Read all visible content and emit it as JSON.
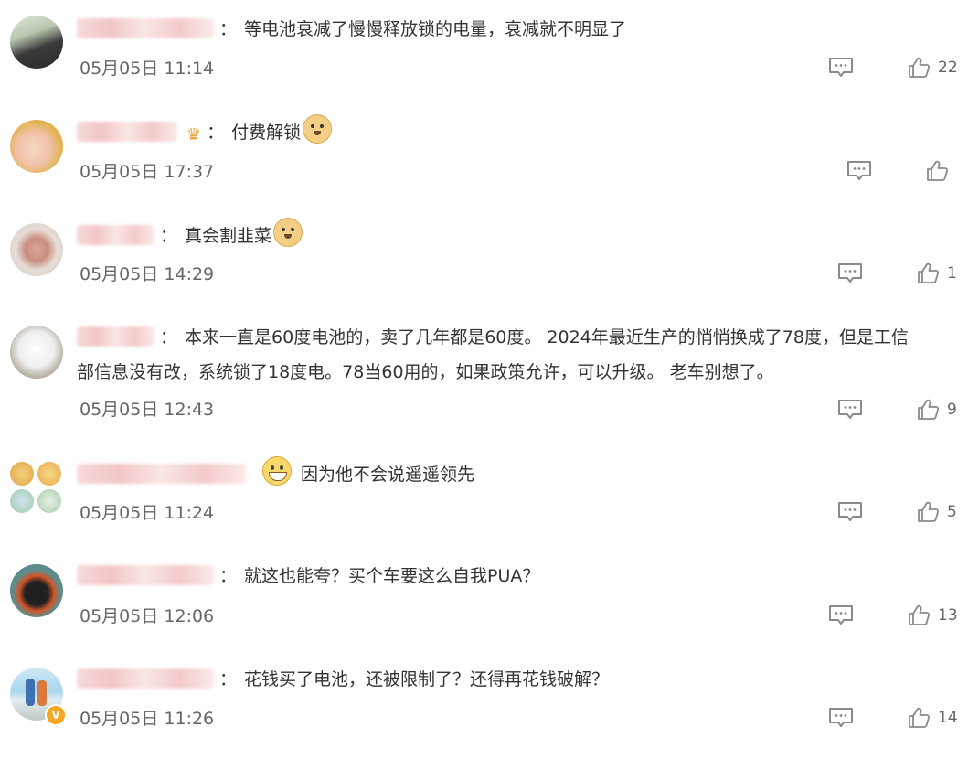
{
  "comments": [
    {
      "text": "等电池衰减了慢慢释放锁的电量，衰减就不明显了",
      "time": "05月05日 11:14",
      "likes": "22"
    },
    {
      "text": "付费解锁",
      "time": "05月05日 17:37",
      "likes": ""
    },
    {
      "text": "真会割韭菜",
      "time": "05月05日 14:29",
      "likes": "1"
    },
    {
      "text_line1": "本来一直是60度电池的，卖了几年都是60度。 2024年最近生产的悄悄换成了78度，但是工信",
      "text_line2": "部信息没有改，系统锁了18度电。78当60用的，如果政策允许，可以升级。 老车别想了。",
      "time": "05月05日 12:43",
      "likes": "9"
    },
    {
      "text": "因为他不会说遥遥领先",
      "time": "05月05日 11:24",
      "likes": "5"
    },
    {
      "text": "就这也能夸？买个车要这么自我PUA？",
      "time": "05月05日 12:06",
      "likes": "13"
    },
    {
      "text": "花钱买了电池，还被限制了？还得再花钱破解？",
      "time": "05月05日 11:26",
      "likes": "14"
    }
  ],
  "colon": "：",
  "icons": {
    "reply": "comment-icon",
    "like": "thumbs-up-icon",
    "emoji_doge": "doge-emoji",
    "emoji_grin": "grin-emoji",
    "crown": "crown-icon",
    "verified": "verified-badge-icon"
  }
}
